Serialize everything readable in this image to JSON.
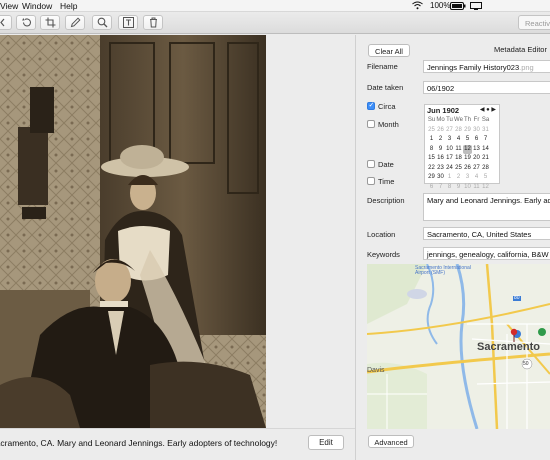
{
  "menubar": {
    "items": [
      "View",
      "Window",
      "Help"
    ],
    "battery": "100%"
  },
  "toolbar": {
    "reactivate_label": "Reactivate"
  },
  "photo": {
    "caption": "Sacramento, CA. Mary and Leonard Jennings. Early adopters of technology!",
    "edit_label": "Edit"
  },
  "panel": {
    "clear_all_label": "Clear All",
    "title": "Metadata Editor",
    "filename_label": "Filename",
    "filename_value": "Jennings Family History023",
    "filename_ext": ".png",
    "date_taken_label": "Date taken",
    "date_taken_value": "06/1902",
    "circa_label": "Circa",
    "circa_checked": true,
    "month_label": "Month",
    "date_label": "Date",
    "time_label": "Time",
    "description_label": "Description",
    "description_value": "Mary and Leonard Jennings. Early adopters of technology!",
    "location_label": "Location",
    "location_value": "Sacramento, CA, United States",
    "keywords_label": "Keywords",
    "keywords_value": "jennings, genealogy, california, B&W",
    "advanced_label": "Advanced"
  },
  "calendar": {
    "month_label": "Jun 1902",
    "weekdays": [
      "Su",
      "Mo",
      "Tu",
      "We",
      "Th",
      "Fr",
      "Sa"
    ],
    "weeks": [
      [
        "25",
        "26",
        "27",
        "28",
        "29",
        "30",
        "31"
      ],
      [
        "1",
        "2",
        "3",
        "4",
        "5",
        "6",
        "7"
      ],
      [
        "8",
        "9",
        "10",
        "11",
        "12",
        "13",
        "14"
      ],
      [
        "15",
        "16",
        "17",
        "18",
        "19",
        "20",
        "21"
      ],
      [
        "22",
        "23",
        "24",
        "25",
        "26",
        "27",
        "28"
      ],
      [
        "29",
        "30",
        "1",
        "2",
        "3",
        "4",
        "5"
      ],
      [
        "6",
        "7",
        "8",
        "9",
        "10",
        "11",
        "12"
      ]
    ],
    "selected": "12"
  },
  "map": {
    "city": "Sacramento",
    "airport": "Sacramento International Airport (SMF)",
    "town_davis": "Davis",
    "route_labels": [
      "50",
      "80"
    ],
    "pin_color": "#d22b2b"
  }
}
